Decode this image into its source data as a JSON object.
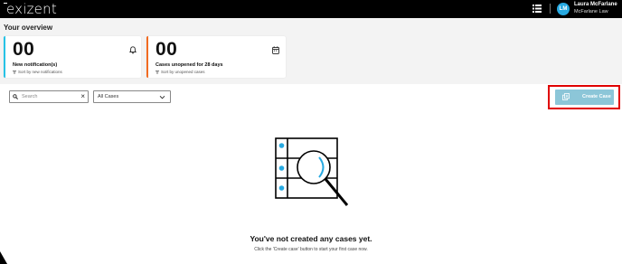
{
  "app": {
    "logo_text": "exizent"
  },
  "topbar": {
    "menu_icon": "list-icon",
    "user": {
      "initials": "LM",
      "name": "Laura McFarlane",
      "firm": "McFarlane Law"
    },
    "colors": {
      "background": "#000000",
      "avatar": "#27a9e1"
    }
  },
  "overview": {
    "title": "Your overview",
    "cards": [
      {
        "count": "00",
        "label": "New notification(s)",
        "sort_text": "Sort by new notifications",
        "icon": "bell-icon",
        "accent": "#27c3e6"
      },
      {
        "count": "00",
        "label": "Cases unopened for 28 days",
        "sort_text": "Sort by unopened cases",
        "icon": "calendar-icon",
        "accent": "#f26b21"
      }
    ]
  },
  "toolbar": {
    "search": {
      "placeholder": "Search",
      "value": "",
      "clear_label": "×"
    },
    "filter": {
      "selected": "All Cases"
    },
    "create_button": {
      "label": "Create Case",
      "color": "#8cc6d8",
      "highlight_color": "#e00000"
    }
  },
  "empty_state": {
    "title": "You've not created any cases yet.",
    "text": "Click the 'Create case' button to start your first case now.",
    "illustration": "search-database-icon"
  }
}
